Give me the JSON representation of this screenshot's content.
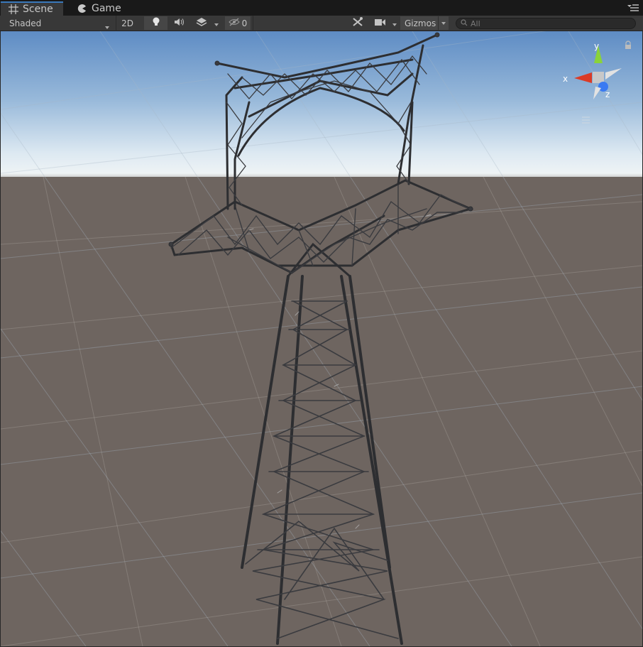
{
  "tabs": [
    {
      "label": "Scene",
      "icon": "grid-icon",
      "active": true
    },
    {
      "label": "Game",
      "icon": "pacman-icon",
      "active": false
    }
  ],
  "toolbar": {
    "shading_mode": "Shaded",
    "mode_2d": "2D",
    "hidden_count": "0",
    "gizmos_label": "Gizmos",
    "search_placeholder": "All"
  },
  "orientation_gizmo": {
    "axis_x": "x",
    "axis_y": "y",
    "axis_z": "z",
    "colors": {
      "x": "#db3b26",
      "y": "#8ad33a",
      "z": "#3a7af2"
    }
  },
  "colors": {
    "sky_top": "#5e8cc4",
    "horizon": "#eef3f5",
    "ground": "#6e6560",
    "tab_highlight": "#3a79bb"
  }
}
